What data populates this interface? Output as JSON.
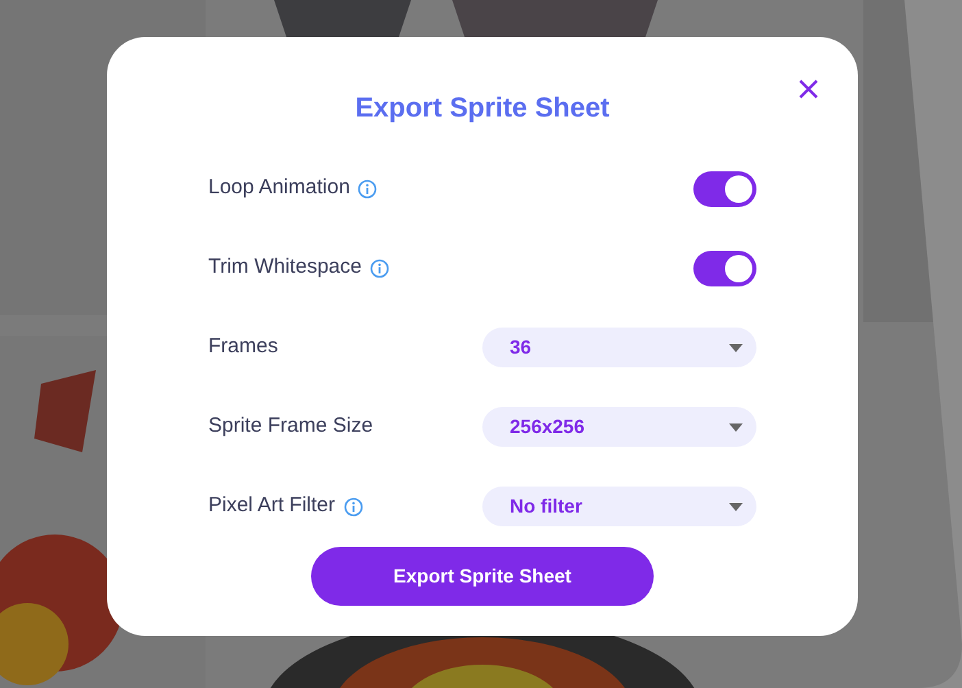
{
  "dialog": {
    "title": "Export Sprite Sheet",
    "settings": [
      {
        "kind": "toggle",
        "label": "Loop Animation",
        "info": true,
        "on": true
      },
      {
        "kind": "toggle",
        "label": "Trim Whitespace",
        "info": true,
        "on": true
      },
      {
        "kind": "select",
        "label": "Frames",
        "info": false,
        "value": "36"
      },
      {
        "kind": "select",
        "label": "Sprite Frame Size",
        "info": false,
        "value": "256x256"
      },
      {
        "kind": "select",
        "label": "Pixel Art Filter",
        "info": true,
        "value": "No filter"
      }
    ],
    "button": "Export Sprite Sheet"
  }
}
